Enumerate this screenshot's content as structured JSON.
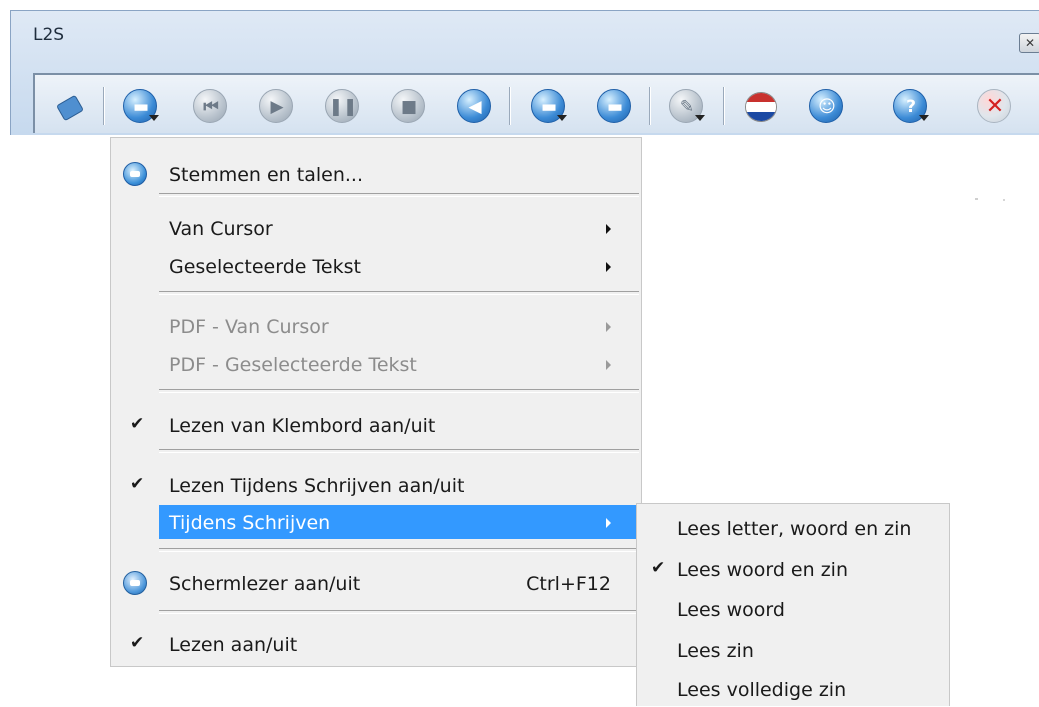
{
  "window": {
    "title": "L2S",
    "close_glyph": "✕"
  },
  "toolbar": {
    "buttons": [
      {
        "name": "settings-icon"
      },
      {
        "name": "speak-menu-icon"
      },
      {
        "name": "previous-icon"
      },
      {
        "name": "play-icon"
      },
      {
        "name": "pause-icon"
      },
      {
        "name": "stop-icon"
      },
      {
        "name": "volume-icon"
      },
      {
        "name": "save-audio-icon"
      },
      {
        "name": "record-power-icon"
      },
      {
        "name": "tools-icon"
      },
      {
        "name": "dutch-flag-icon"
      },
      {
        "name": "voices-icon"
      },
      {
        "name": "help-icon"
      },
      {
        "name": "exit-icon"
      }
    ]
  },
  "menu": {
    "voices_and_languages": "Stemmen en talen...",
    "from_cursor": "Van Cursor",
    "selected_text": "Geselecteerde Tekst",
    "pdf_from_cursor": "PDF - Van Cursor",
    "pdf_selected_text": "PDF - Geselecteerde Tekst",
    "read_clipboard": "Lezen van Klembord aan/uit",
    "read_while_typing": "Lezen Tijdens Schrijven aan/uit",
    "while_typing": "Tijdens Schrijven",
    "screen_reader": "Schermlezer aan/uit",
    "screen_reader_shortcut": "Ctrl+F12",
    "read_toggle": "Lezen aan/uit",
    "check_mark": "✔"
  },
  "submenu": {
    "items": [
      {
        "label": "Lees letter, woord en zin",
        "checked": false
      },
      {
        "label": "Lees woord en zin",
        "checked": true
      },
      {
        "label": "Lees woord",
        "checked": false
      },
      {
        "label": "Lees zin",
        "checked": false
      },
      {
        "label": "Lees volledige zin",
        "checked": false
      }
    ],
    "check_mark": "✔"
  },
  "colors": {
    "highlight": "#3399ff",
    "menu_bg": "#f0f0f0",
    "disabled_text": "#8c8c8c"
  }
}
